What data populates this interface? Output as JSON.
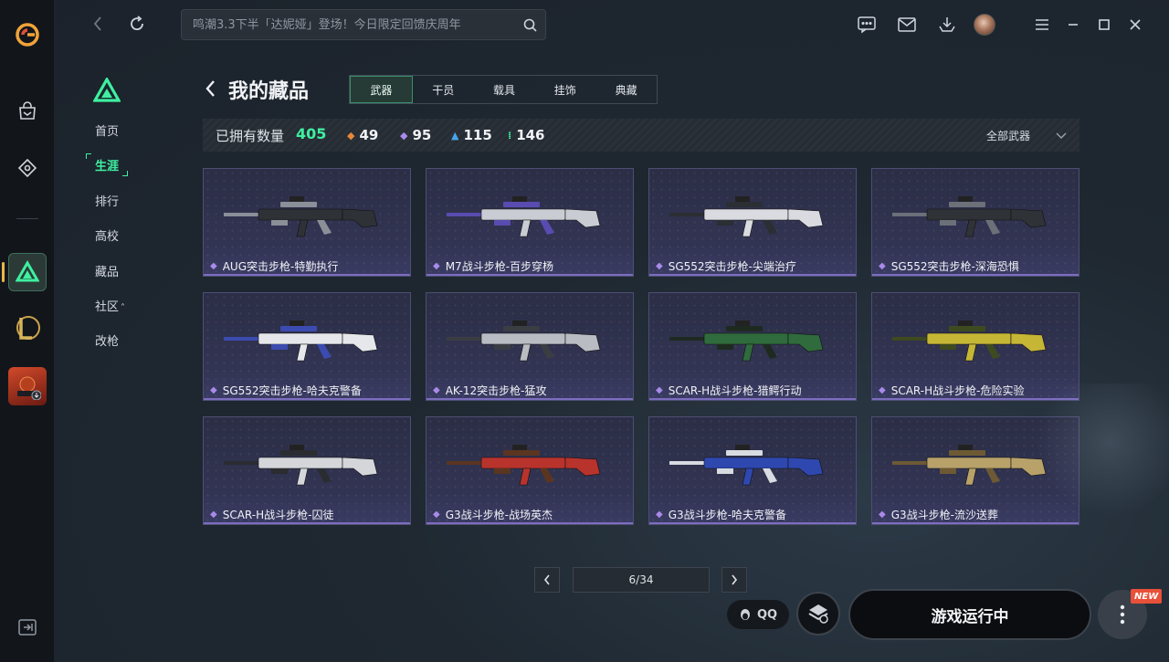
{
  "search": {
    "placeholder": "鸣潮3.3下半「达妮娅」登场！今日限定回馈庆周年"
  },
  "sidemenu": {
    "items": [
      {
        "label": "首页"
      },
      {
        "label": "生涯"
      },
      {
        "label": "排行"
      },
      {
        "label": "高校"
      },
      {
        "label": "藏品"
      },
      {
        "label": "社区"
      },
      {
        "label": "改枪"
      }
    ],
    "community_suffix": "˄"
  },
  "header": {
    "title": "我的藏品",
    "tabs": [
      "武器",
      "干员",
      "载具",
      "挂饰",
      "典藏"
    ],
    "active_tab": "武器"
  },
  "stats": {
    "owned_label": "已拥有数量",
    "owned_value": "405",
    "rarities": [
      {
        "value": "49",
        "color": "#e8873a",
        "icon": "orange-diamond-icon"
      },
      {
        "value": "95",
        "color": "#a98ae9",
        "icon": "purple-diamond-icon"
      },
      {
        "value": "115",
        "color": "#4aa3e8",
        "icon": "blue-chevron-icon"
      },
      {
        "value": "146",
        "color": "#3ef0a0",
        "icon": "green-dots-icon"
      }
    ],
    "filter_label": "全部武器"
  },
  "cards": [
    {
      "label": "AUG突击步枪-特勤执行",
      "body": "#2e3136",
      "accent": "#8a8f98"
    },
    {
      "label": "M7战斗步枪-百步穿杨",
      "body": "#c9ccd2",
      "accent": "#5a4bb0"
    },
    {
      "label": "SG552突击步枪-尖端治疗",
      "body": "#d9dbe0",
      "accent": "#2b2e33"
    },
    {
      "label": "SG552突击步枪-深海恐惧",
      "body": "#2f3237",
      "accent": "#6b7079"
    },
    {
      "label": "SG552突击步枪-哈夫克警备",
      "body": "#e6e7ea",
      "accent": "#3b4bb0"
    },
    {
      "label": "AK-12突击步枪-猛攻",
      "body": "#b9bcc2",
      "accent": "#3a3d42"
    },
    {
      "label": "SCAR-H战斗步枪-猎鳄行动",
      "body": "#2f6b3c",
      "accent": "#1e2a20"
    },
    {
      "label": "SCAR-H战斗步枪-危险实验",
      "body": "#c6b636",
      "accent": "#3e4a1f"
    },
    {
      "label": "SCAR-H战斗步枪-囚徒",
      "body": "#d4d6da",
      "accent": "#2a2c30"
    },
    {
      "label": "G3战斗步枪-战场英杰",
      "body": "#b8332c",
      "accent": "#5a3520"
    },
    {
      "label": "G3战斗步枪-哈夫克警备",
      "body": "#2e48b0",
      "accent": "#d8dbe0"
    },
    {
      "label": "G3战斗步枪-流沙送葬",
      "body": "#b8a26a",
      "accent": "#6d5a34"
    }
  ],
  "pager": {
    "text": "6/34"
  },
  "bottom": {
    "qq_label": "QQ",
    "game_status": "游戏运行中",
    "new_badge": "NEW"
  },
  "colors": {
    "accent_green": "#3ef0a0",
    "rail_active": "#e8b84a"
  }
}
